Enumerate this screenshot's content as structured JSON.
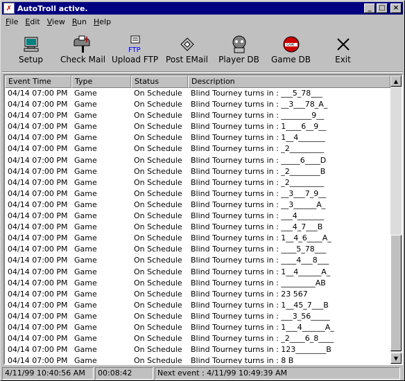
{
  "window": {
    "title": "AutoTroll active."
  },
  "menu": [
    {
      "label": "File",
      "key": "F",
      "rest": "ile"
    },
    {
      "label": "Edit",
      "key": "E",
      "rest": "dit"
    },
    {
      "label": "View",
      "key": "V",
      "rest": "iew"
    },
    {
      "label": "Run",
      "key": "R",
      "rest": "un"
    },
    {
      "label": "Help",
      "key": "H",
      "rest": "elp"
    }
  ],
  "toolbar": [
    {
      "label": "Setup",
      "icon": "setup-icon"
    },
    {
      "label": "Check Mail",
      "icon": "mailbox-icon"
    },
    {
      "label": "Upload FTP",
      "icon": "ftp-icon"
    },
    {
      "label": "Post EMail",
      "icon": "post-email-icon"
    },
    {
      "label": "Player DB",
      "icon": "player-db-icon"
    },
    {
      "label": "Game DB",
      "icon": "game-db-icon"
    },
    {
      "label": "Exit",
      "icon": "exit-icon"
    }
  ],
  "columns": [
    "Event Time",
    "Type",
    "Status",
    "Description"
  ],
  "rows": [
    [
      "04/14 07:00 PM",
      "Game",
      "On Schedule",
      "Blind Tourney turns in : ___5_78___"
    ],
    [
      "04/14 07:00 PM",
      "Game",
      "On Schedule",
      "Blind Tourney turns in : __3___78_A_"
    ],
    [
      "04/14 07:00 PM",
      "Game",
      "On Schedule",
      "Blind Tourney turns in : ________9__"
    ],
    [
      "04/14 07:00 PM",
      "Game",
      "On Schedule",
      "Blind Tourney turns in : 1____6__9__"
    ],
    [
      "04/14 07:00 PM",
      "Game",
      "On Schedule",
      "Blind Tourney turns in : 1__4_______"
    ],
    [
      "04/14 07:00 PM",
      "Game",
      "On Schedule",
      "Blind Tourney turns in : _2_________"
    ],
    [
      "04/14 07:00 PM",
      "Game",
      "On Schedule",
      "Blind Tourney turns in : _____6____D"
    ],
    [
      "04/14 07:00 PM",
      "Game",
      "On Schedule",
      "Blind Tourney turns in : _2________B"
    ],
    [
      "04/14 07:00 PM",
      "Game",
      "On Schedule",
      "Blind Tourney turns in : _2_________"
    ],
    [
      "04/14 07:00 PM",
      "Game",
      "On Schedule",
      "Blind Tourney turns in : __3___7_9__"
    ],
    [
      "04/14 07:00 PM",
      "Game",
      "On Schedule",
      "Blind Tourney turns in : __3______A_"
    ],
    [
      "04/14 07:00 PM",
      "Game",
      "On Schedule",
      "Blind Tourney turns in : ___4_______"
    ],
    [
      "04/14 07:00 PM",
      "Game",
      "On Schedule",
      "Blind Tourney turns in : ___4_7___B"
    ],
    [
      "04/14 07:00 PM",
      "Game",
      "On Schedule",
      "Blind Tourney turns in : 1__4_6____A_"
    ],
    [
      "04/14 07:00 PM",
      "Game",
      "On Schedule",
      "Blind Tourney turns in : ____5_78___"
    ],
    [
      "04/14 07:00 PM",
      "Game",
      "On Schedule",
      "Blind Tourney turns in : ____4___8___"
    ],
    [
      "04/14 07:00 PM",
      "Game",
      "On Schedule",
      "Blind Tourney turns in : 1__4______A_"
    ],
    [
      "04/14 07:00 PM",
      "Game",
      "On Schedule",
      "Blind Tourney turns in : _________AB"
    ],
    [
      "04/14 07:00 PM",
      "Game",
      "On Schedule",
      "Blind Tourney turns in :  23  567"
    ],
    [
      "04/14 07:00 PM",
      "Game",
      "On Schedule",
      "Blind Tourney turns in : 1__45_7___B"
    ],
    [
      "04/14 07:00 PM",
      "Game",
      "On Schedule",
      "Blind Tourney turns in : ___3_56_____"
    ],
    [
      "04/14 07:00 PM",
      "Game",
      "On Schedule",
      "Blind Tourney turns in : 1___4______A_"
    ],
    [
      "04/14 07:00 PM",
      "Game",
      "On Schedule",
      "Blind Tourney turns in : _2____6_8____"
    ],
    [
      "04/14 07:00 PM",
      "Game",
      "On Schedule",
      "Blind Tourney turns in : 123________B"
    ],
    [
      "04/14 07:00 PM",
      "Game",
      "On Schedule",
      "Blind Tourney turns in :            8   B"
    ]
  ],
  "status": {
    "time": "4/11/99 10:40:56 AM",
    "elapsed": "00:08:42",
    "next_event": "Next event : 4/11/99 10:49:39 AM"
  }
}
